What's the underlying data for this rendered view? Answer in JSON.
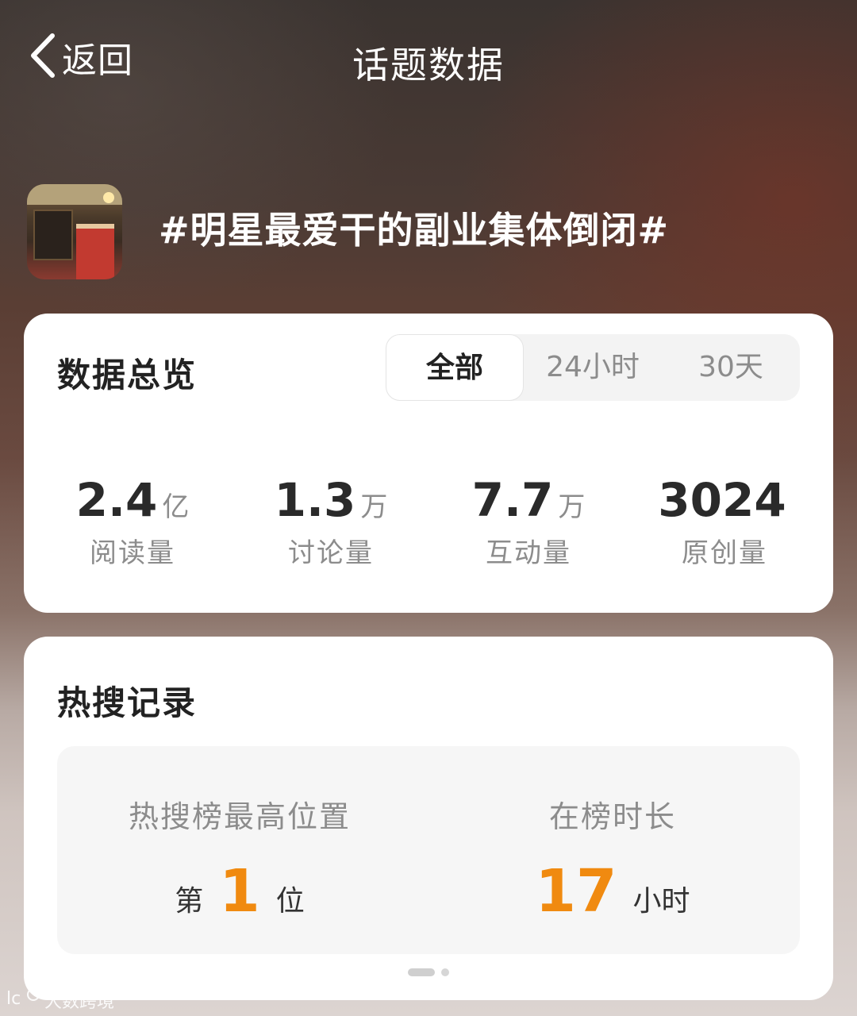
{
  "nav": {
    "back_label": "返回",
    "title": "话题数据"
  },
  "topic": {
    "title": "#明星最爱干的副业集体倒闭#"
  },
  "overview": {
    "title": "数据总览",
    "tabs": [
      "全部",
      "24小时",
      "30天"
    ],
    "active_tab": "全部",
    "stats": [
      {
        "value": "2.4",
        "unit": "亿",
        "label": "阅读量"
      },
      {
        "value": "1.3",
        "unit": "万",
        "label": "讨论量"
      },
      {
        "value": "7.7",
        "unit": "万",
        "label": "互动量"
      },
      {
        "value": "3024",
        "unit": "",
        "label": "原创量"
      }
    ]
  },
  "hot_search": {
    "title": "热搜记录",
    "peak": {
      "label": "热搜榜最高位置",
      "prefix": "第",
      "value": "1",
      "suffix": "位"
    },
    "duration": {
      "label": "在榜时长",
      "value": "17",
      "suffix": "小时"
    }
  },
  "watermark": {
    "text": "大数跨境"
  },
  "colors": {
    "accent": "#f08a10",
    "card": "#ffffff",
    "muted": "#8c8c8c"
  }
}
